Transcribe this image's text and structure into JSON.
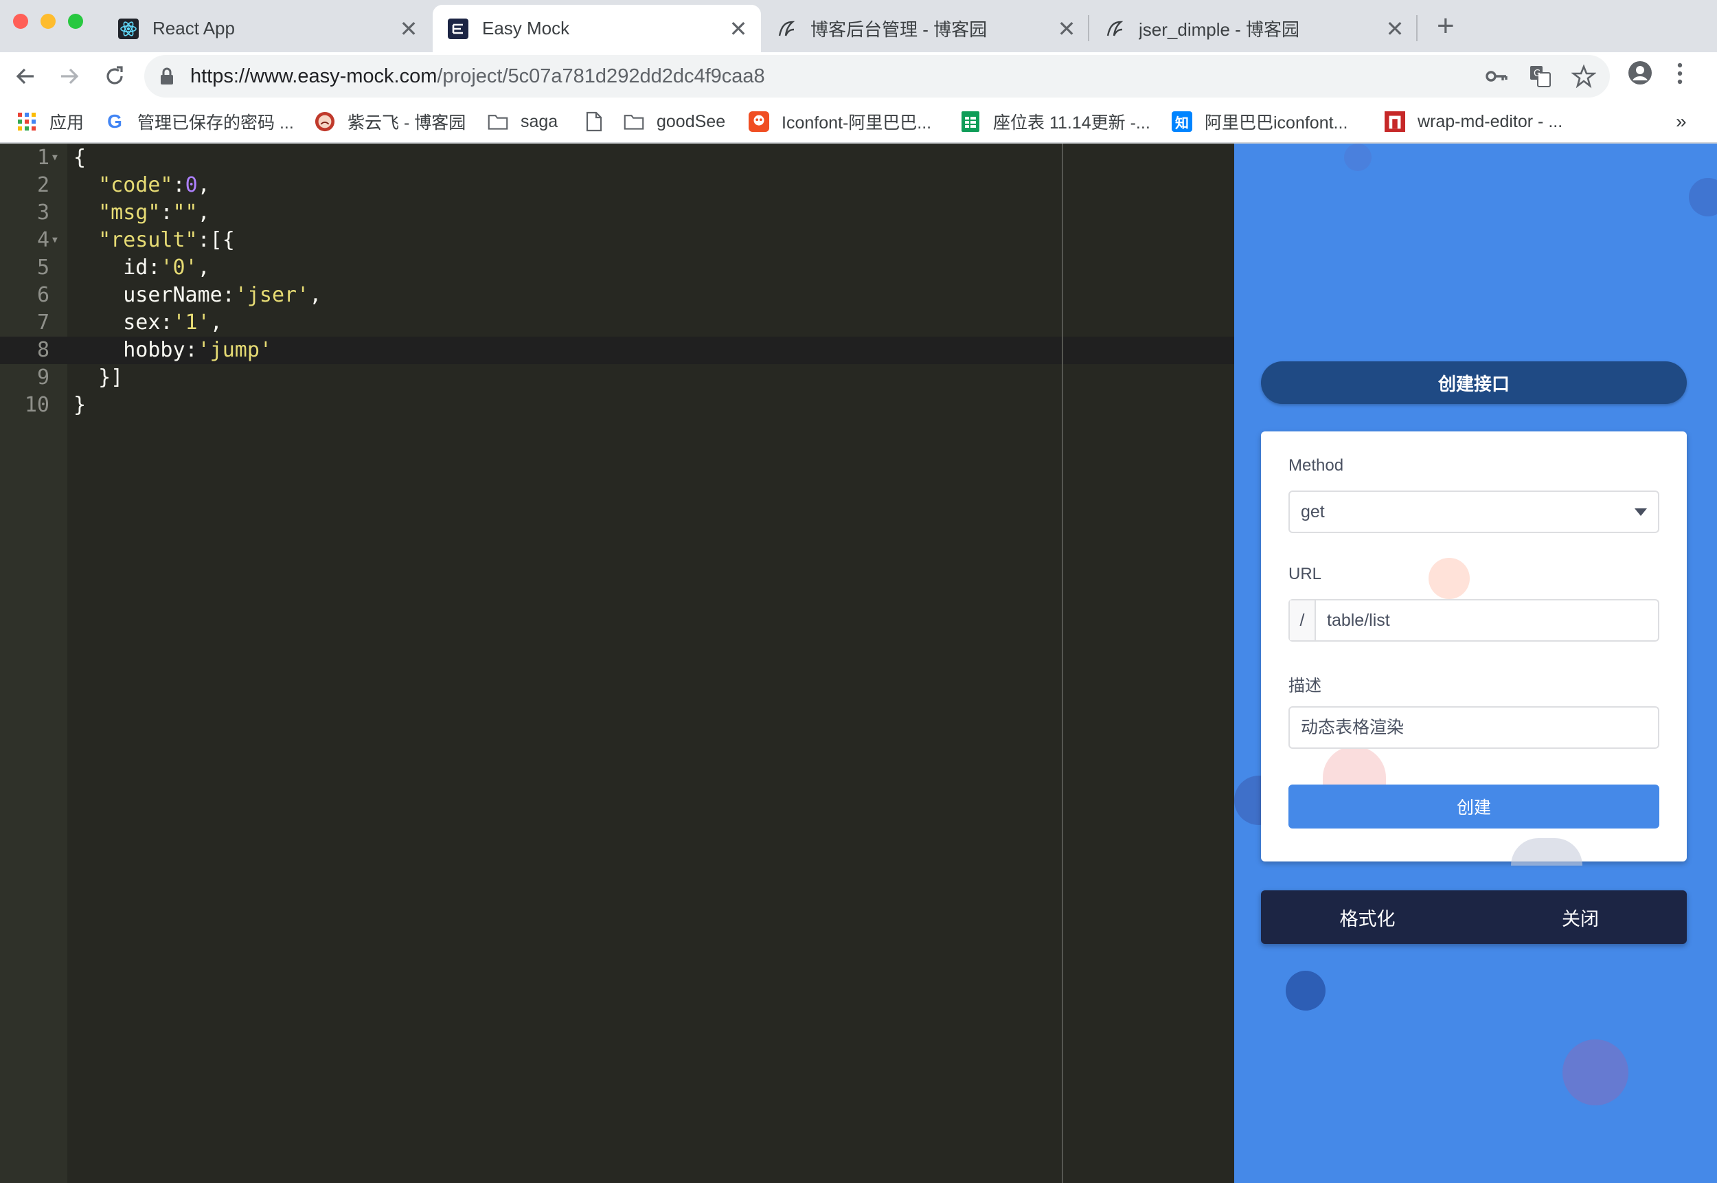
{
  "browser": {
    "tabs": [
      {
        "title": "React App",
        "icon": "react-icon",
        "active": false
      },
      {
        "title": "Easy Mock",
        "icon": "easy-mock-logo-icon",
        "active": true
      },
      {
        "title": "博客后台管理 - 博客园",
        "icon": "cnblogs-icon",
        "active": false
      },
      {
        "title": "jser_dimple - 博客园",
        "icon": "cnblogs-icon",
        "active": false
      }
    ],
    "close_glyph": "✕",
    "new_tab_glyph": "+",
    "url_host": "https://www.easy-mock.com",
    "url_path": "/project/5c07a781d292dd2dc4f9caa8",
    "bookmarks": [
      {
        "label": "应用",
        "icon": "apps-grid-icon"
      },
      {
        "label": "管理已保存的密码 ...",
        "icon": "google-icon"
      },
      {
        "label": "紫云飞 - 博客园",
        "icon": "avatar-icon"
      },
      {
        "label": "saga",
        "icon": "folder-icon"
      },
      {
        "label": "",
        "icon": "page-icon"
      },
      {
        "label": "goodSee",
        "icon": "folder-icon"
      },
      {
        "label": "Iconfont-阿里巴巴...",
        "icon": "iconfont-icon"
      },
      {
        "label": "座位表 11.14更新 -...",
        "icon": "sheets-icon"
      },
      {
        "label": "阿里巴巴iconfont...",
        "icon": "zhihu-icon"
      },
      {
        "label": "wrap-md-editor - ...",
        "icon": "editor-icon"
      }
    ],
    "more_bookmarks": "»"
  },
  "colors": {
    "editor_bg": "#272822",
    "panel_bg": "#4589e8",
    "primary_button": "#1f4a84",
    "action_bar": "#1c2544",
    "string": "#e6db74",
    "number": "#ae81ff"
  },
  "editor": {
    "line_numbers": [
      "1",
      "2",
      "3",
      "4",
      "5",
      "6",
      "7",
      "8",
      "9",
      "10"
    ],
    "active_line": 8,
    "lines": [
      [
        {
          "t": "txt",
          "v": "{"
        }
      ],
      [
        {
          "t": "txt",
          "v": "  "
        },
        {
          "t": "str",
          "v": "\"code\""
        },
        {
          "t": "txt",
          "v": ":"
        },
        {
          "t": "num",
          "v": "0"
        },
        {
          "t": "txt",
          "v": ","
        }
      ],
      [
        {
          "t": "txt",
          "v": "  "
        },
        {
          "t": "str",
          "v": "\"msg\""
        },
        {
          "t": "txt",
          "v": ":"
        },
        {
          "t": "str",
          "v": "\"\""
        },
        {
          "t": "txt",
          "v": ","
        }
      ],
      [
        {
          "t": "txt",
          "v": "  "
        },
        {
          "t": "str",
          "v": "\"result\""
        },
        {
          "t": "txt",
          "v": ":[{"
        }
      ],
      [
        {
          "t": "txt",
          "v": "    id:"
        },
        {
          "t": "str",
          "v": "'0'"
        },
        {
          "t": "txt",
          "v": ","
        }
      ],
      [
        {
          "t": "txt",
          "v": "    userName:"
        },
        {
          "t": "str",
          "v": "'jser'"
        },
        {
          "t": "txt",
          "v": ","
        }
      ],
      [
        {
          "t": "txt",
          "v": "    sex:"
        },
        {
          "t": "str",
          "v": "'1'"
        },
        {
          "t": "txt",
          "v": ","
        }
      ],
      [
        {
          "t": "txt",
          "v": "    hobby:"
        },
        {
          "t": "str",
          "v": "'jump'"
        }
      ],
      [
        {
          "t": "txt",
          "v": "  }]"
        }
      ],
      [
        {
          "t": "txt",
          "v": "}"
        }
      ]
    ]
  },
  "panel": {
    "create_api_label": "创建接口",
    "method_label": "Method",
    "method_value": "get",
    "url_label": "URL",
    "url_prefix": "/",
    "url_value": "table/list",
    "desc_label": "描述",
    "desc_value": "动态表格渲染",
    "submit_label": "创建",
    "format_label": "格式化",
    "close_label": "关闭"
  }
}
